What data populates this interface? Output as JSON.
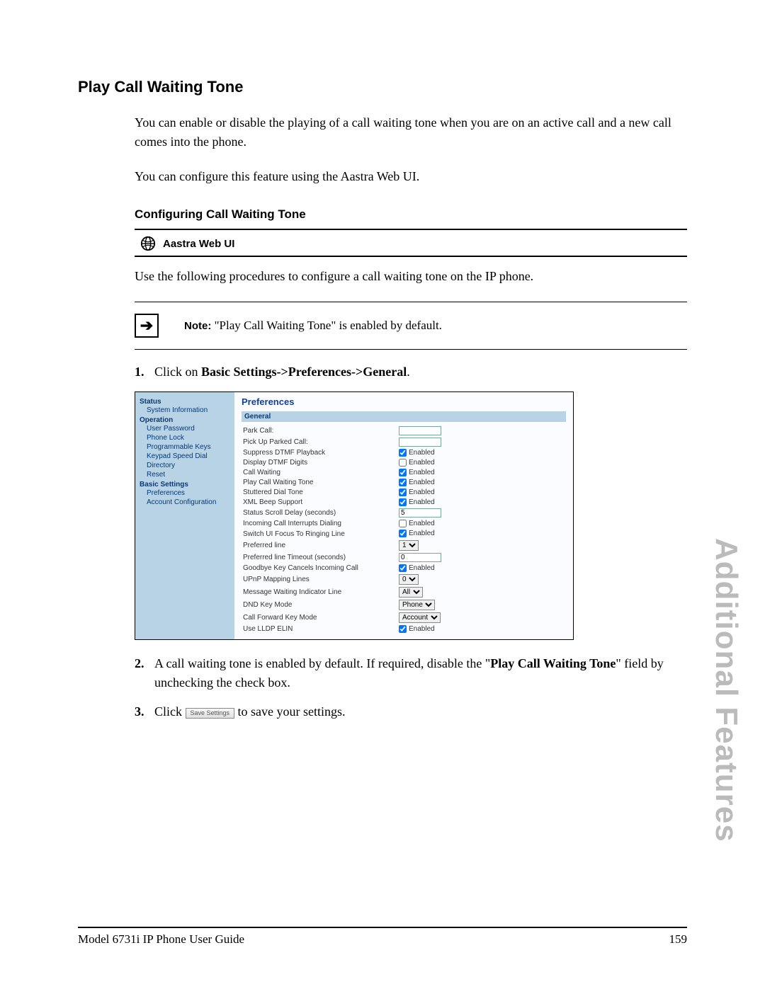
{
  "title": "Play Call Waiting Tone",
  "para1": "You can enable or disable the playing of a call waiting tone when you are on an active call and a new call comes into the phone.",
  "para2": "You can configure this feature using the Aastra Web UI.",
  "subheading": "Configuring Call Waiting Tone",
  "webui_label": "Aastra Web UI",
  "para3": "Use the following procedures to configure a call waiting tone on the IP phone.",
  "note_label": "Note:",
  "note_text": "\"Play Call Waiting Tone\" is enabled by default.",
  "steps": {
    "s1_pre": "Click on ",
    "s1_bold": "Basic Settings->Preferences->General",
    "s1_post": ".",
    "s2_pre": "A call waiting tone is enabled by default. If required, disable the \"",
    "s2_bold": "Play Call Waiting Tone",
    "s2_post": "\" field by unchecking the check box.",
    "s3_pre": "Click ",
    "s3_btn": "Save Settings",
    "s3_post": " to save your settings."
  },
  "screenshot": {
    "side": {
      "status": "Status",
      "sysinfo": "System Information",
      "operation": "Operation",
      "userpass": "User Password",
      "phonelock": "Phone Lock",
      "progkeys": "Programmable Keys",
      "keypad": "Keypad Speed Dial",
      "directory": "Directory",
      "reset": "Reset",
      "basic": "Basic Settings",
      "prefs": "Preferences",
      "acct": "Account Configuration"
    },
    "main": {
      "title": "Preferences",
      "general": "General",
      "rows": {
        "park": "Park Call:",
        "pickup": "Pick Up Parked Call:",
        "sdtmf": "Suppress DTMF Playback",
        "ddtmf": "Display DTMF Digits",
        "cw": "Call Waiting",
        "pcwt": "Play Call Waiting Tone",
        "sdt": "Stuttered Dial Tone",
        "xml": "XML Beep Support",
        "ssd": "Status Scroll Delay (seconds)",
        "icid": "Incoming Call Interrupts Dialing",
        "sufrl": "Switch UI Focus To Ringing Line",
        "pline": "Preferred line",
        "plt": "Preferred line Timeout (seconds)",
        "gkcic": "Goodbye Key Cancels Incoming Call",
        "upnp": "UPnP Mapping Lines",
        "mwil": "Message Waiting Indicator Line",
        "dnd": "DND Key Mode",
        "cfw": "Call Forward Key Mode",
        "lldp": "Use LLDP ELIN"
      },
      "enabled": "Enabled",
      "values": {
        "ssd": "5",
        "pline": "1",
        "plt": "0",
        "upnp": "0",
        "mwil": "All",
        "dnd": "Phone",
        "cfw": "Account"
      }
    }
  },
  "side_watermark": "Additional Features",
  "footer_left": "Model 6731i IP Phone User Guide",
  "footer_right": "159"
}
